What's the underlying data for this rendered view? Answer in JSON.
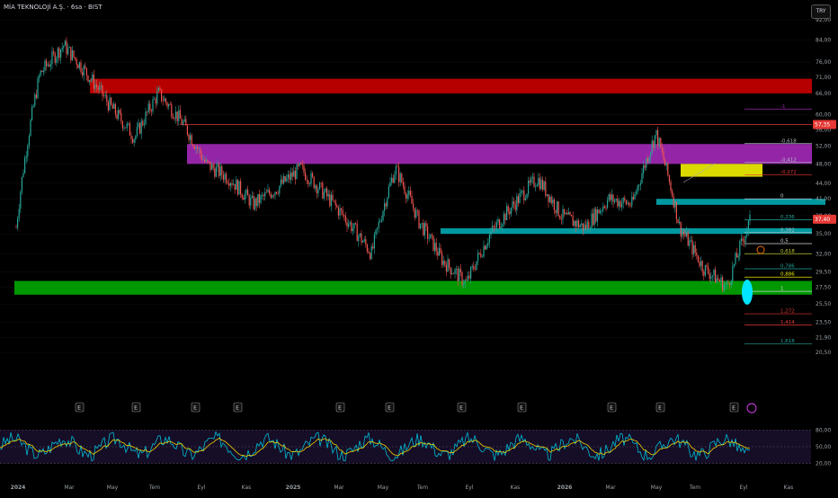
{
  "header": {
    "title": "MİA TEKNOLOJİ A.Ş. · 6sa · BIST",
    "currency_button": "TRY"
  },
  "colors": {
    "up": "#26a69a",
    "down": "#ef5350",
    "red_zone": "#c00000",
    "magenta_zone": "#9c27b0",
    "yellow_zone": "#e6e600",
    "teal_zone": "#00a0a8",
    "green_zone": "#00a000",
    "rsi": "#00bcd4",
    "rsi_ma": "#f0d000"
  },
  "chart_data": {
    "type": "candlestick",
    "title": "MİA TEKNOLOJİ A.Ş. · 6sa · BIST",
    "y_axis": {
      "scale": "log",
      "ticks": [
        92.0,
        84.0,
        76.0,
        71.0,
        66.0,
        60.0,
        56.0,
        52.0,
        48.0,
        44.0,
        41.0,
        38.0,
        35.0,
        32.0,
        29.5,
        27.5,
        25.5,
        23.5,
        21.9,
        20.5
      ]
    },
    "y_tick_labels": [
      "92,00",
      "84,00",
      "76,00",
      "71,00",
      "66,00",
      "60,00",
      "56,00",
      "52,00",
      "48,00",
      "44,00",
      "41,00",
      "38,00",
      "35,00",
      "32,00",
      "29,50",
      "27,50",
      "25,50",
      "23,50",
      "21,90",
      "20,50"
    ],
    "x_axis_labels": [
      "2024",
      "Mar",
      "May",
      "Tem",
      "Eyl",
      "Kas",
      "2025",
      "Mar",
      "May",
      "Tem",
      "Eyl",
      "Kas",
      "2026",
      "Mar",
      "May",
      "Tem",
      "Eyl",
      "Kas"
    ],
    "price_path": [
      {
        "x": "2024",
        "y": 36
      },
      {
        "x": "Mar",
        "y": 72
      },
      {
        "x": "Mar",
        "y": 82
      },
      {
        "x": "Mar",
        "y": 72
      },
      {
        "x": "May",
        "y": 62
      },
      {
        "x": "May",
        "y": 54
      },
      {
        "x": "Tem",
        "y": 66
      },
      {
        "x": "Tem",
        "y": 58
      },
      {
        "x": "Eyl",
        "y": 48
      },
      {
        "x": "Eyl",
        "y": 45
      },
      {
        "x": "Kas",
        "y": 40
      },
      {
        "x": "Kas",
        "y": 43
      },
      {
        "x": "2025",
        "y": 47
      },
      {
        "x": "2025",
        "y": 42
      },
      {
        "x": "Mar",
        "y": 37
      },
      {
        "x": "Mar",
        "y": 32
      },
      {
        "x": "Mar",
        "y": 47
      },
      {
        "x": "May",
        "y": 37
      },
      {
        "x": "May",
        "y": 31
      },
      {
        "x": "Tem",
        "y": 28
      },
      {
        "x": "Tem",
        "y": 35
      },
      {
        "x": "Eyl",
        "y": 40
      },
      {
        "x": "Eyl",
        "y": 45
      },
      {
        "x": "Kas",
        "y": 38
      },
      {
        "x": "2026",
        "y": 36
      },
      {
        "x": "Mar",
        "y": 41
      },
      {
        "x": "May",
        "y": 40
      },
      {
        "x": "May",
        "y": 55
      },
      {
        "x": "Tem",
        "y": 36
      },
      {
        "x": "Tem",
        "y": 30
      },
      {
        "x": "Eyl",
        "y": 27.5
      },
      {
        "x": "Eyl",
        "y": 37.4
      }
    ],
    "zones": [
      {
        "name": "red",
        "top": 70.5,
        "bottom": 66.0,
        "color": "#c00000"
      },
      {
        "name": "magenta",
        "top": 52.5,
        "bottom": 48.0,
        "color": "#9c27b0"
      },
      {
        "name": "yellow",
        "top": 48.0,
        "bottom": 45.3,
        "color": "#e6e600"
      },
      {
        "name": "teal-upper",
        "top": 41.0,
        "bottom": 39.9,
        "color": "#00a0a8"
      },
      {
        "name": "teal-lower",
        "top": 35.9,
        "bottom": 35.0,
        "color": "#00a0a8"
      },
      {
        "name": "green",
        "top": 28.3,
        "bottom": 26.6,
        "color": "#00a000"
      }
    ],
    "horizontal_lines": [
      {
        "value": 57.35,
        "label": "57,35",
        "color": "#e53935"
      }
    ],
    "fibonacci": [
      {
        "label": "-1",
        "value": 61.5,
        "color": "#9c27b0"
      },
      {
        "label": "-0,618",
        "value": 52.6,
        "color": "#b0bec5"
      },
      {
        "label": "-0,412",
        "value": 48.3,
        "color": "#b0bec5"
      },
      {
        "label": "-0,272",
        "value": 45.7,
        "color": "#e53935"
      },
      {
        "label": "0",
        "value": 41.0,
        "color": "#d1d4dc"
      },
      {
        "label": "0,236",
        "value": 37.3,
        "color": "#26a69a"
      },
      {
        "label": "0,382",
        "value": 35.2,
        "color": "#b0bec5"
      },
      {
        "label": "0,5",
        "value": 33.5,
        "color": "#d1d4dc"
      },
      {
        "label": "0,618",
        "value": 32.0,
        "color": "#c0ca33"
      },
      {
        "label": "0,786",
        "value": 29.9,
        "color": "#26a69a"
      },
      {
        "label": "0,886",
        "value": 28.8,
        "color": "#e6e600"
      },
      {
        "label": "1",
        "value": 27.0,
        "color": "#d1d4dc"
      },
      {
        "label": "1,272",
        "value": 24.4,
        "color": "#e53935"
      },
      {
        "label": "1,414",
        "value": 23.2,
        "color": "#e53935"
      },
      {
        "label": "1,618",
        "value": 21.3,
        "color": "#26a69a"
      }
    ],
    "current_price": {
      "value": 37.4,
      "label": "37,40",
      "color": "#e53935"
    },
    "earnings_markers": {
      "label": "E",
      "x": [
        "Mar",
        "Tem",
        "Eyl",
        "2025",
        "Mar",
        "May",
        "Tem",
        "Eyl",
        "2026",
        "May",
        "Tem",
        "Eyl"
      ]
    },
    "rsi_panel": {
      "ticks": [
        80,
        50,
        20
      ],
      "tick_labels": [
        "80,00",
        "50,00",
        "20,00"
      ],
      "series": [
        "RSI",
        "RSI MA"
      ]
    }
  }
}
